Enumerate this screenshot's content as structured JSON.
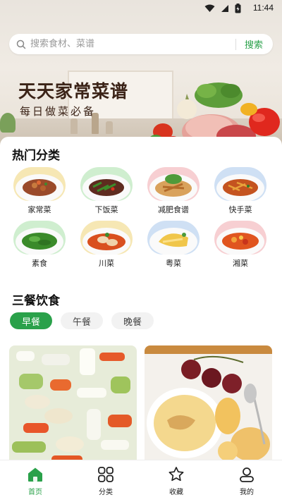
{
  "status_bar": {
    "time": "11:44"
  },
  "search": {
    "placeholder": "搜索食材、菜谱",
    "button_label": "搜索"
  },
  "banner": {
    "title": "天天家常菜谱",
    "subtitle": "每日做菜必备"
  },
  "hot_categories": {
    "title": "热门分类",
    "items": [
      {
        "label": "家常菜",
        "ring": "#f6e7b4"
      },
      {
        "label": "下饭菜",
        "ring": "#cfeecf"
      },
      {
        "label": "减肥食谱",
        "ring": "#f7cfd2"
      },
      {
        "label": "快手菜",
        "ring": "#cfe0f4"
      },
      {
        "label": "素食",
        "ring": "#cfeecf"
      },
      {
        "label": "川菜",
        "ring": "#f6e7b4"
      },
      {
        "label": "粤菜",
        "ring": "#cfe0f4"
      },
      {
        "label": "湘菜",
        "ring": "#f7cfd2"
      }
    ]
  },
  "meals": {
    "title": "三餐饮食",
    "tabs": [
      {
        "label": "早餐",
        "active": true
      },
      {
        "label": "午餐",
        "active": false
      },
      {
        "label": "晚餐",
        "active": false
      }
    ]
  },
  "bottom_nav": {
    "items": [
      {
        "label": "首页",
        "icon": "home-icon",
        "active": true
      },
      {
        "label": "分类",
        "icon": "grid-icon",
        "active": false
      },
      {
        "label": "收藏",
        "icon": "star-icon",
        "active": false
      },
      {
        "label": "我的",
        "icon": "user-icon",
        "active": false
      }
    ]
  },
  "colors": {
    "accent": "#2aa14a",
    "banner_text": "#3b2317"
  }
}
